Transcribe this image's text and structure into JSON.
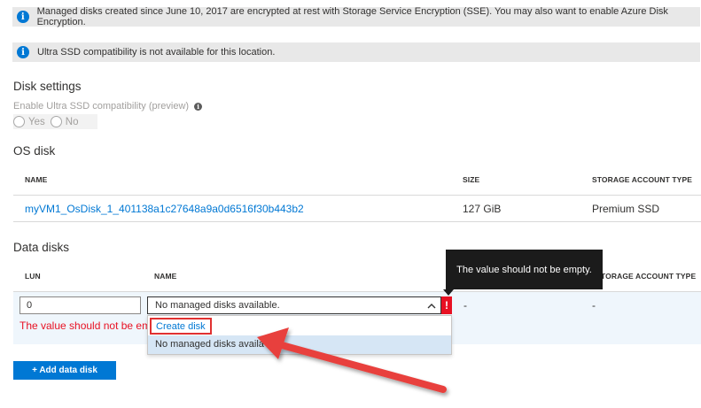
{
  "info": {
    "sse_message": "Managed disks created since June 10, 2017 are encrypted at rest with Storage Service Encryption (SSE). You may also want to enable Azure Disk Encryption.",
    "ultra_message": "Ultra SSD compatibility is not available for this location.",
    "info_icon_glyph": "i"
  },
  "disk_settings": {
    "title": "Disk settings",
    "ultra_label": "Enable Ultra SSD compatibility (preview)",
    "yes_label": "Yes",
    "no_label": "No"
  },
  "os_disk": {
    "title": "OS disk",
    "headers": {
      "name": "NAME",
      "size": "SIZE",
      "storage": "STORAGE ACCOUNT TYPE"
    },
    "row": {
      "name": "myVM1_OsDisk_1_401138a1c27648a9a0d6516f30b443b2",
      "size": "127 GiB",
      "storage": "Premium SSD"
    }
  },
  "data_disks": {
    "title": "Data disks",
    "headers": {
      "lun": "LUN",
      "name": "NAME",
      "storage_partial": "TORAGE ACCOUNT TYPE"
    },
    "row": {
      "lun_value": "0",
      "name_value": "No managed disks available.",
      "size_value": "-",
      "storage_value": "-",
      "error_text": "The value should not be em"
    },
    "tooltip": "The value should not be empty.",
    "dropdown_options": [
      "Create disk",
      "No managed disks availa"
    ],
    "add_button": "+ Add data disk"
  },
  "colors": {
    "accent": "#0078d4",
    "error": "#e81123",
    "highlight_border": "#e03131",
    "arrow": "#e8413c",
    "tooltip_bg": "#1b1b1b"
  }
}
